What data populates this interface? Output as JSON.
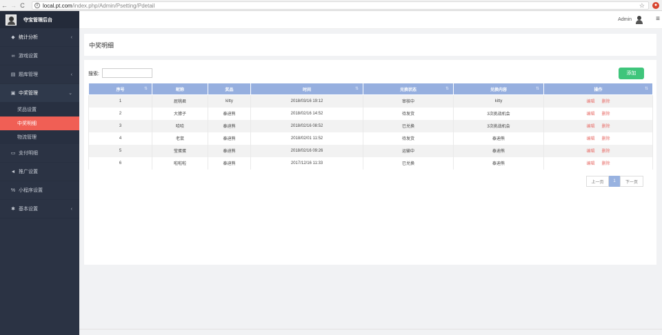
{
  "browser": {
    "back_icon": "←",
    "forward_icon": "→",
    "reload_icon": "C",
    "url_host": "local.pt.com",
    "url_path": "/index.php/Admin/Psetting/Pdetail",
    "star_icon": "☆"
  },
  "sidebar": {
    "title": "夺宝管理后台",
    "menu": [
      {
        "label": "统计分析",
        "icon": "◆",
        "chevron": "‹"
      },
      {
        "label": "游戏设置",
        "icon": "∞"
      },
      {
        "label": "题库管理",
        "icon": "▤",
        "chevron": "‹"
      },
      {
        "label": "中奖管理",
        "icon": "▣",
        "chevron": "⌄"
      },
      {
        "label": "支付明细",
        "icon": "▭"
      },
      {
        "label": "推广设置",
        "icon": "◄"
      },
      {
        "label": "小程序设置",
        "icon": "%"
      },
      {
        "label": "基本设置",
        "icon": "✱",
        "chevron": "‹"
      }
    ],
    "submenu": [
      {
        "label": "奖品设置"
      },
      {
        "label": "中奖明细"
      },
      {
        "label": "物流管理"
      }
    ]
  },
  "header": {
    "admin": "Admin",
    "menu_icon": "≡"
  },
  "page": {
    "title": "中奖明细",
    "search_label": "搜索:",
    "search_value": "",
    "add_label": "添加"
  },
  "table": {
    "columns": [
      "序号",
      "昵称",
      "奖品",
      "时间",
      "兑换状态",
      "兑换内容",
      "操作"
    ],
    "rows": [
      {
        "id": "1",
        "nick": "屁桃君",
        "prize": "kitty",
        "time": "2018/03/16 19:12",
        "status": "审核中",
        "content": "kitty"
      },
      {
        "id": "2",
        "nick": "大獴子",
        "prize": "泰迪熊",
        "time": "2018/02/16 14:52",
        "status": "待发货",
        "content": "3次挑战机会"
      },
      {
        "id": "3",
        "nick": "哈哈",
        "prize": "泰迪熊",
        "time": "2018/02/16 08:52",
        "status": "已兑换",
        "content": "3次挑战机会"
      },
      {
        "id": "4",
        "nick": "老鼠",
        "prize": "泰迪熊",
        "time": "2018/02/01 11:52",
        "status": "待发货",
        "content": "泰迪熊"
      },
      {
        "id": "5",
        "nick": "莹蛋蛋",
        "prize": "泰迪熊",
        "time": "2018/02/16 09:26",
        "status": "运输中",
        "content": "泰迪熊"
      },
      {
        "id": "6",
        "nick": "啦啦啦",
        "prize": "泰迪熊",
        "time": "2017/12/16 11:33",
        "status": "已兑换",
        "content": "泰迪熊"
      }
    ],
    "edit_label": "编辑",
    "delete_label": "删除",
    "sort_icon": "⇅"
  },
  "pager": {
    "prev": "上一页",
    "current": "1",
    "next": "下一页"
  },
  "colors": {
    "sidebar_bg": "#2b3344",
    "active_item": "#f05f55",
    "table_header": "#96afdf",
    "add_button": "#3fc57b"
  }
}
